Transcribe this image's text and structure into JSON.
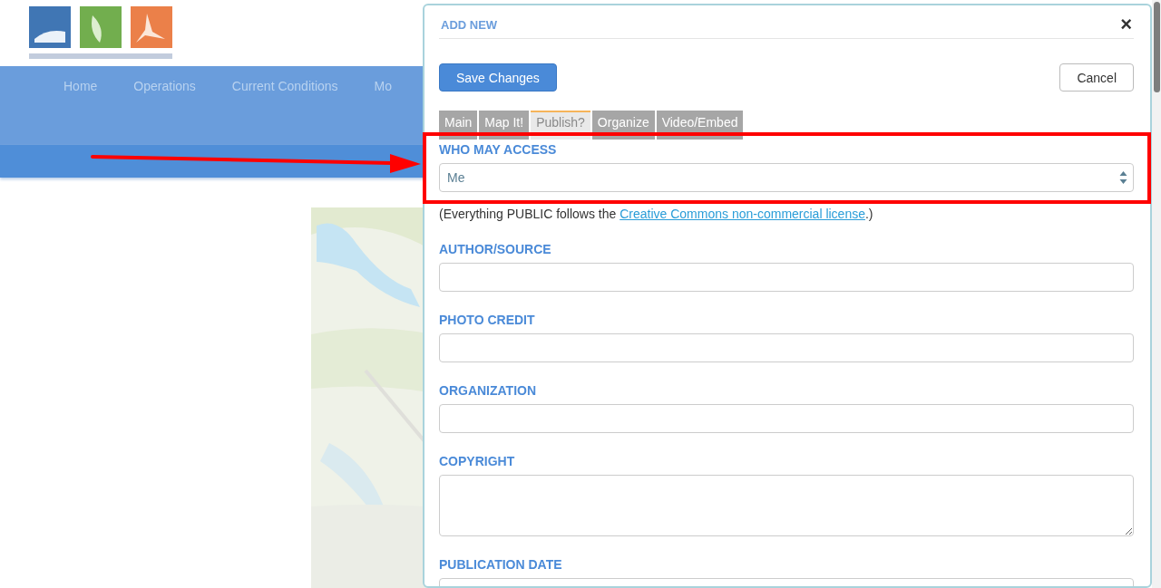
{
  "nav": {
    "items": [
      "Home",
      "Operations",
      "Current Conditions",
      "Mo"
    ]
  },
  "dialog": {
    "title": "ADD NEW",
    "close": "×",
    "buttons": [
      {
        "kind": "primary",
        "label": "Save Changes"
      },
      {
        "kind": "default",
        "label": "Cancel"
      }
    ],
    "tabs": [
      {
        "label": "Main",
        "selected": false
      },
      {
        "label": "Map It!",
        "selected": false
      },
      {
        "label": "Publish?",
        "selected": true
      },
      {
        "label": "Organize",
        "selected": false
      },
      {
        "label": "Video/Embed",
        "selected": false
      }
    ],
    "fields": [
      {
        "kind": "select",
        "label": "WHO MAY ACCESS",
        "value": "Me",
        "note": {
          "before": "(Everything PUBLIC follows the ",
          "link": "Creative Commons non-commercial license",
          "after": ".)"
        }
      },
      {
        "kind": "text",
        "label": "AUTHOR/SOURCE"
      },
      {
        "kind": "text",
        "label": "PHOTO CREDIT"
      },
      {
        "kind": "text",
        "label": "ORGANIZATION"
      },
      {
        "kind": "textarea",
        "label": "COPYRIGHT"
      },
      {
        "kind": "text",
        "label": "PUBLICATION DATE"
      }
    ]
  }
}
